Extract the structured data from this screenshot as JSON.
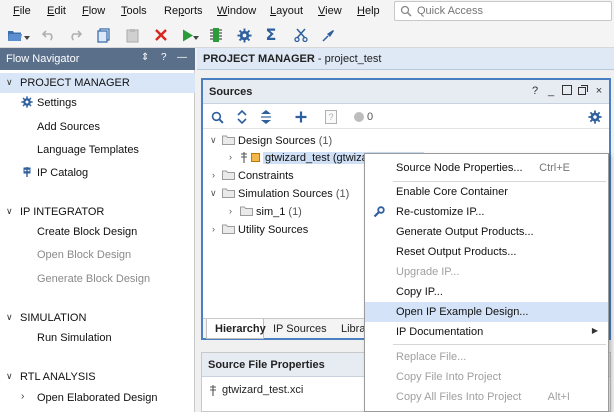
{
  "menubar": {
    "items": [
      "File",
      "Edit",
      "Flow",
      "Tools",
      "Reports",
      "Window",
      "Layout",
      "View",
      "Help"
    ],
    "underline": [
      "F",
      "E",
      "F",
      "T",
      "p",
      "W",
      "L",
      "V",
      "H"
    ],
    "quick_access_placeholder": "Quick Access"
  },
  "toolbar": {
    "icons": [
      "open-project-icon",
      "undo-icon",
      "redo-icon",
      "copy-icon",
      "paste-icon",
      "delete-icon",
      "run-icon",
      "program-device-icon",
      "settings-icon",
      "sigma-icon",
      "cut-icon",
      "pin-icon"
    ]
  },
  "flow_navigator": {
    "title": "Flow Navigator",
    "controls": [
      "⇕",
      "?",
      "—"
    ],
    "sections": [
      {
        "label": "PROJECT MANAGER",
        "expanded": true,
        "selected": true
      },
      {
        "label": "IP INTEGRATOR",
        "expanded": true
      },
      {
        "label": "SIMULATION",
        "expanded": true
      },
      {
        "label": "RTL ANALYSIS",
        "expanded": true
      }
    ],
    "items": {
      "settings": "Settings",
      "add_sources": "Add Sources",
      "language_templates": "Language Templates",
      "ip_catalog": "IP Catalog",
      "create_block_design": "Create Block Design",
      "open_block_design": "Open Block Design",
      "generate_block_design": "Generate Block Design",
      "run_simulation": "Run Simulation",
      "open_elaborated_design": "Open Elaborated Design"
    }
  },
  "project_manager": {
    "label": "PROJECT MANAGER",
    "project": " - project_test"
  },
  "sources": {
    "title": "Sources",
    "toolbar_badge": "0",
    "tree": {
      "design_sources": "Design Sources",
      "design_sources_count": "(1)",
      "gtwizard": "gtwizard_test (gtwizard_test.xci)",
      "constraints": "Constraints",
      "simulation_sources": "Simulation Sources",
      "simulation_sources_count": "(1)",
      "sim_1": "sim_1",
      "sim_1_count": "(1)",
      "utility_sources": "Utility Sources"
    },
    "tabs": [
      "Hierarchy",
      "IP Sources",
      "Libraries"
    ]
  },
  "source_file_properties": {
    "title": "Source File Properties",
    "file": "gtwizard_test.xci"
  },
  "context_menu": {
    "items": [
      {
        "label": "Source Node Properties...",
        "shortcut": "Ctrl+E"
      },
      {
        "label": "Enable Core Container"
      },
      {
        "label": "Re-customize IP..."
      },
      {
        "label": "Generate Output Products..."
      },
      {
        "label": "Reset Output Products..."
      },
      {
        "label": "Upgrade IP...",
        "disabled": true
      },
      {
        "label": "Copy IP..."
      },
      {
        "label": "Open IP Example Design...",
        "hover": true
      },
      {
        "label": "IP Documentation",
        "submenu": true
      },
      {
        "label": "Replace File...",
        "disabled": true
      },
      {
        "label": "Copy File Into Project",
        "disabled": true
      },
      {
        "label": "Copy All Files Into Project",
        "shortcut": "Alt+I",
        "disabled": true
      }
    ]
  },
  "colors": {
    "navigator_header": "#5a6f8a",
    "selection": "#d9e6f7",
    "active_panel_border": "#4a7fc1",
    "menu_hover": "#d4e3f8"
  }
}
